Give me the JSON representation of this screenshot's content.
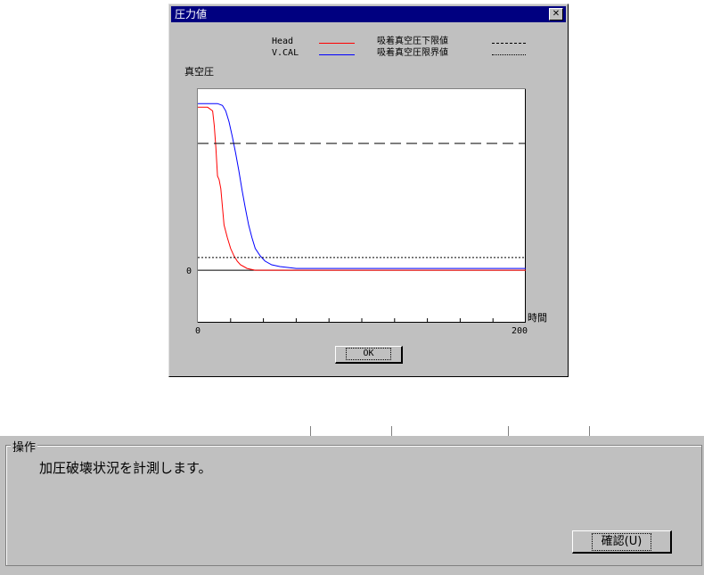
{
  "dialog": {
    "title": "圧力値",
    "close_label": "✕",
    "ok_label": "OK",
    "legend": {
      "head_label": "Head",
      "vcal_label": "V.CAL",
      "lower_limit_label": "吸着真空圧下限値",
      "limit_label": "吸着真空圧限界値"
    }
  },
  "chart_data": {
    "type": "line",
    "ylabel": "真空圧",
    "xlabel": "時間",
    "x_tick_labels": [
      "0",
      "200"
    ],
    "y_tick_labels": [
      "0"
    ],
    "xlim": [
      0,
      200
    ],
    "ylim": [
      -29,
      100
    ],
    "series": [
      {
        "name": "Head",
        "color": "#ff0000",
        "x": [
          0,
          6,
          9,
          10,
          11,
          12,
          13,
          14,
          15,
          16,
          18,
          20,
          22,
          24,
          26,
          28,
          30,
          35,
          40,
          50,
          70,
          100,
          150,
          200
        ],
        "y": [
          90,
          90,
          88,
          80,
          68,
          52,
          50,
          45,
          35,
          25,
          18,
          12,
          8,
          5,
          3,
          2,
          1,
          0,
          0,
          0,
          0,
          0,
          0,
          0
        ]
      },
      {
        "name": "V.CAL",
        "color": "#0000ff",
        "x": [
          0,
          12,
          15,
          17,
          19,
          21,
          23,
          25,
          27,
          29,
          31,
          33,
          35,
          38,
          41,
          45,
          50,
          60,
          80,
          120,
          160,
          200
        ],
        "y": [
          92,
          92,
          91,
          88,
          82,
          74,
          65,
          55,
          44,
          34,
          25,
          18,
          12,
          8,
          5,
          3,
          2,
          1,
          1,
          1,
          1,
          1
        ]
      },
      {
        "name": "吸着真空圧下限値",
        "color": "#000000",
        "style": "dashed",
        "x": [
          0,
          200
        ],
        "y": [
          70,
          70
        ]
      },
      {
        "name": "吸着真空圧限界値",
        "color": "#000000",
        "style": "dotted",
        "x": [
          0,
          200
        ],
        "y": [
          7,
          7
        ]
      }
    ],
    "x_ticks": [
      20,
      40,
      60,
      80,
      100,
      120,
      140,
      160,
      180
    ],
    "grid": false,
    "legend_position": "top"
  },
  "operation": {
    "group_label": "操作",
    "message": "加圧破壊状況を計測します。",
    "confirm_label": "確認(U)"
  }
}
